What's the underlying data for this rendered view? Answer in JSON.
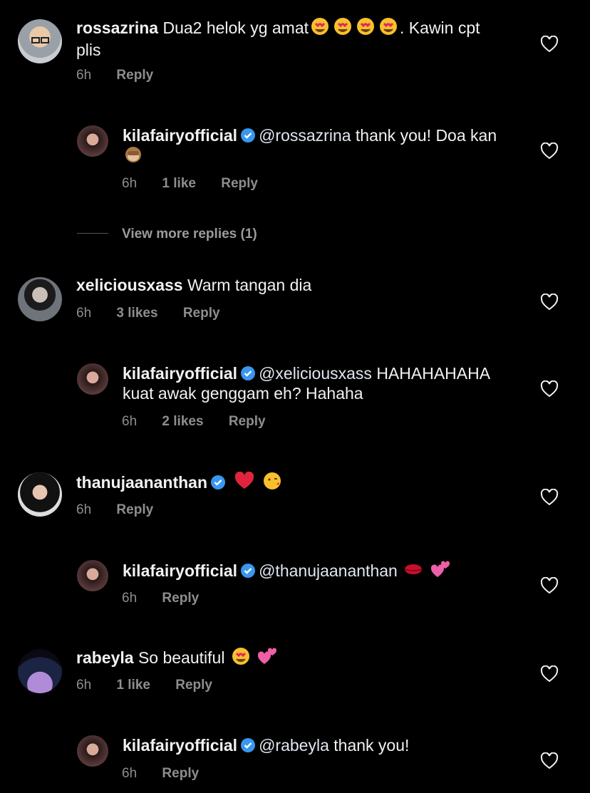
{
  "comments": [
    {
      "user": "rossazrina",
      "verified": false,
      "text": "Dua2 helok yg amat",
      "emojis": [
        "heart-eyes",
        "heart-eyes",
        "heart-eyes",
        "heart-eyes"
      ],
      "tail": ". Kawin cpt plis",
      "time": "6h",
      "likes": "",
      "reply": "Reply"
    },
    {
      "user": "kilafairyofficial",
      "verified": true,
      "mention": "@rossazrina",
      "text": "thank you! Doa kan",
      "emojis": [
        "see-no-evil"
      ],
      "time": "6h",
      "likes": "1 like",
      "reply": "Reply"
    },
    {
      "user": "xeliciousxass",
      "verified": false,
      "text": "Warm tangan dia",
      "emojis": [],
      "time": "6h",
      "likes": "3 likes",
      "reply": "Reply"
    },
    {
      "user": "kilafairyofficial",
      "verified": true,
      "mention": "@xeliciousxass",
      "text": "HAHAHAHAHA kuat awak genggam eh? Hahaha",
      "emojis": [],
      "time": "6h",
      "likes": "2 likes",
      "reply": "Reply"
    },
    {
      "user": "thanujaananthan",
      "verified": true,
      "text": "",
      "emojis": [
        "red-heart",
        "kiss-face"
      ],
      "time": "6h",
      "likes": "",
      "reply": "Reply"
    },
    {
      "user": "kilafairyofficial",
      "verified": true,
      "mention": "@thanujaananthan",
      "text": "",
      "emojis": [
        "lips",
        "two-hearts"
      ],
      "time": "6h",
      "likes": "",
      "reply": "Reply"
    },
    {
      "user": "rabeyla",
      "verified": false,
      "text": "So beautiful",
      "emojis": [
        "heart-eyes",
        "two-hearts"
      ],
      "time": "6h",
      "likes": "1 like",
      "reply": "Reply"
    },
    {
      "user": "kilafairyofficial",
      "verified": true,
      "mention": "@rabeyla",
      "text": "thank you!",
      "emojis": [],
      "time": "6h",
      "likes": "",
      "reply": "Reply"
    }
  ],
  "view_more": "View more replies (1)",
  "colors": {
    "background": "#000000",
    "meta": "#8e8e8e",
    "verified": "#3897f0"
  }
}
